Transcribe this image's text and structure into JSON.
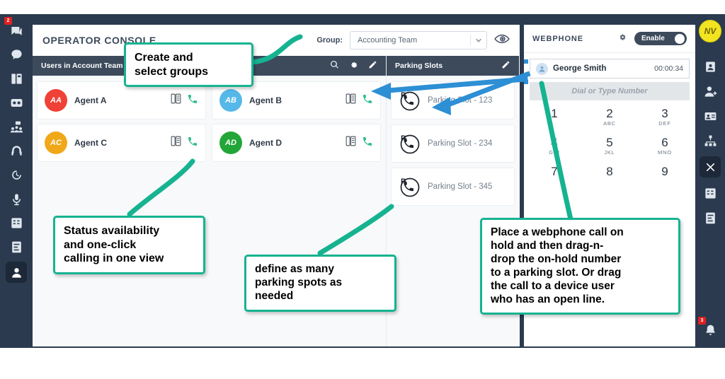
{
  "app": {
    "console_title": "OPERATOR CONSOLE",
    "group_label": "Group:",
    "group_value": "Accounting Team"
  },
  "users_pane": {
    "title": "Users in Account Team",
    "actions": [
      "search-icon",
      "gear-icon",
      "edit-icon"
    ],
    "users": [
      {
        "initials": "AA",
        "name": "Agent A",
        "color": "#ef4136"
      },
      {
        "initials": "AB",
        "name": "Agent B",
        "color": "#56b8e8"
      },
      {
        "initials": "AC",
        "name": "Agent C",
        "color": "#f0a819"
      },
      {
        "initials": "AD",
        "name": "Agent D",
        "color": "#23a638"
      }
    ]
  },
  "parking_pane": {
    "title": "Parking Slots",
    "slots": [
      {
        "name": "Parking Slot - 123"
      },
      {
        "name": "Parking Slot - 234"
      },
      {
        "name": "Parking Slot - 345"
      }
    ]
  },
  "webphone": {
    "title": "WEBPHONE",
    "toggle_label": "Enable",
    "active_call": {
      "name": "George Smith",
      "duration": "00:00:34"
    },
    "dial_placeholder": "Dial or Type Number",
    "keys": [
      {
        "digit": "1",
        "letters": ""
      },
      {
        "digit": "2",
        "letters": "ABC"
      },
      {
        "digit": "3",
        "letters": "DEF"
      },
      {
        "digit": "4",
        "letters": "GHI"
      },
      {
        "digit": "5",
        "letters": "JKL"
      },
      {
        "digit": "6",
        "letters": "MNO"
      },
      {
        "digit": "7",
        "letters": ""
      },
      {
        "digit": "8",
        "letters": ""
      },
      {
        "digit": "9",
        "letters": ""
      }
    ]
  },
  "left_rail": {
    "badge_count": "2",
    "items": [
      "messages-icon",
      "chat-icon",
      "desk-phone-icon",
      "voicemail-icon",
      "team-icon",
      "headset-icon",
      "history-icon",
      "microphone-icon",
      "keypad-icon",
      "notes-icon",
      "user-profile-icon"
    ]
  },
  "right_rail": {
    "avatar_initials": "NV",
    "bell_badge": "3",
    "items": [
      "contact-card-icon",
      "add-user-icon",
      "id-card-icon",
      "org-chart-icon",
      "close-icon",
      "keypad-icon",
      "notes-icon"
    ]
  },
  "callouts": {
    "groups": {
      "line1": "Create and",
      "line2": "select groups"
    },
    "status": {
      "line1": "Status availability",
      "line2": "and one-click",
      "line3": "calling in one view"
    },
    "parking": {
      "line1": "define as many",
      "line2": "parking spots as",
      "line3": "needed"
    },
    "webphone": {
      "line1": "Place a webphone call on",
      "line2": "hold and then drag-n-",
      "line3": "drop the on-hold number",
      "line4": "to a parking slot. Or drag",
      "line5": "the call to a device user",
      "line6": "who has an open line."
    }
  },
  "colors": {
    "frame": "#2b3a4f",
    "accent_green": "#16b391",
    "arrow_blue": "#2d8fd5"
  }
}
